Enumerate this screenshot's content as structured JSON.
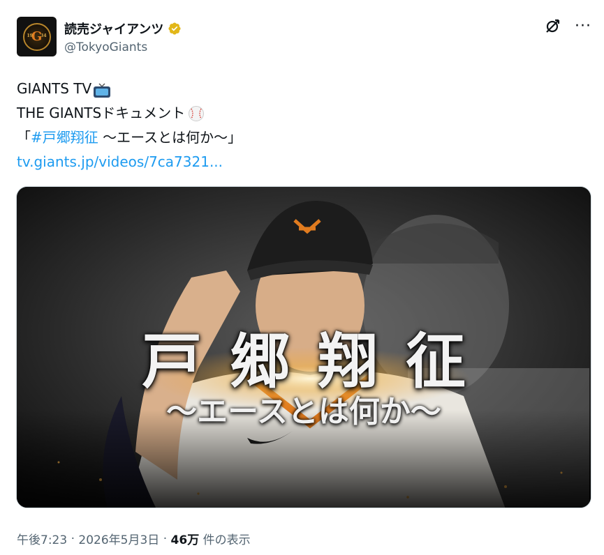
{
  "author": {
    "display_name": "読売ジャイアンツ",
    "handle": "@TokyoGiants",
    "avatar_icon": "giants-logo-icon",
    "verified_icon": "verified-badge-icon",
    "verified_color": "#e2b719"
  },
  "actions": {
    "grok_icon": "grok-icon",
    "more_icon": "more-options-icon"
  },
  "tweet": {
    "line1_text": "GIANTS TV",
    "line1_emoji": "tv-emoji",
    "line2_text": "THE GIANTSドキュメント",
    "line2_emoji": "baseball-emoji",
    "line3_open": "「",
    "line3_hashtag": "#戸郷翔征",
    "line3_rest": " 〜エースとは何か〜」",
    "link": "tv.giants.jp/videos/7ca7321..."
  },
  "media": {
    "title": "戸郷翔征",
    "subtitle": "〜エースとは何か〜"
  },
  "meta": {
    "time": "午後7:23",
    "sep1": " · ",
    "date": "2026年5月3日",
    "sep2": " · ",
    "views": "46万",
    "views_label": " 件の表示"
  },
  "colors": {
    "link_blue": "#1d9bf0",
    "secondary_text": "#536471",
    "giants_orange": "#e07b1f"
  }
}
